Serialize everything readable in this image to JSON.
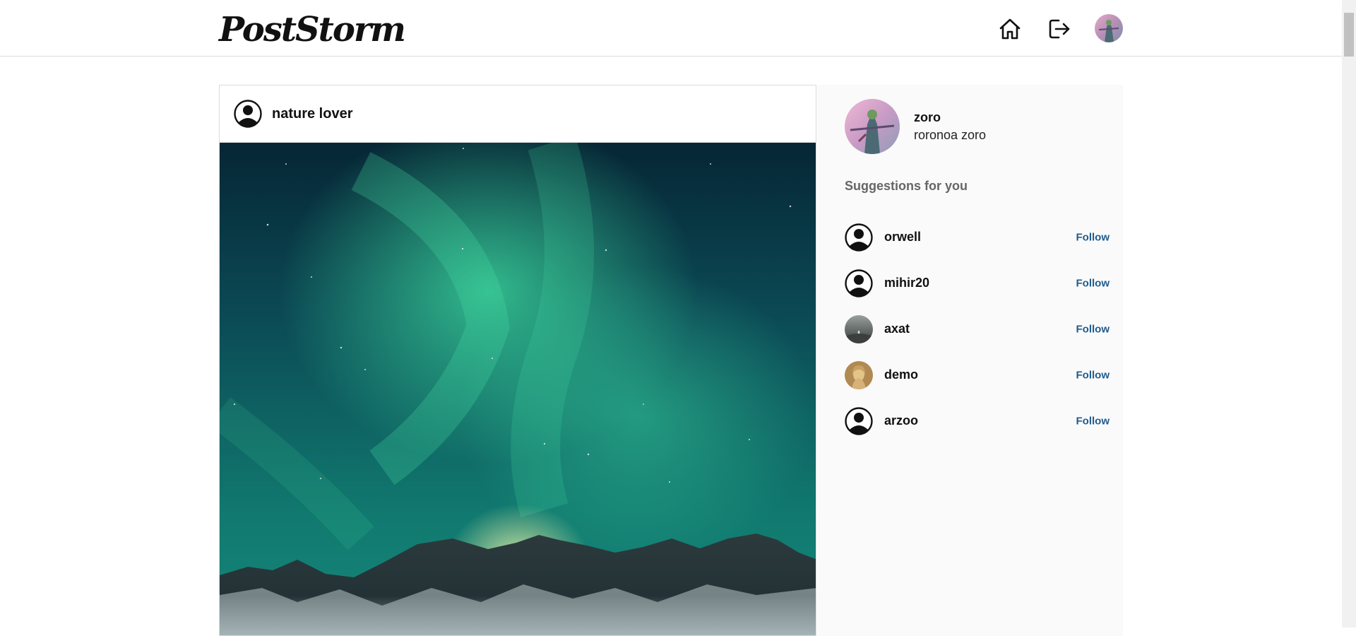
{
  "header": {
    "logo": "PostStorm",
    "home_icon": "home-icon",
    "logout_icon": "logout-icon",
    "avatar_icon": "avatar"
  },
  "post": {
    "username": "nature lover",
    "avatar_icon": "default-user-icon",
    "image_subject": "aurora-over-mountains"
  },
  "sidebar": {
    "me": {
      "username": "zoro",
      "full_name": "roronoa zoro"
    },
    "suggestions_title": "Suggestions for you",
    "suggestions": [
      {
        "username": "orwell",
        "avatar": "default-user-icon",
        "action": "Follow"
      },
      {
        "username": "mihir20",
        "avatar": "default-user-icon",
        "action": "Follow"
      },
      {
        "username": "axat",
        "avatar": "photo",
        "action": "Follow"
      },
      {
        "username": "demo",
        "avatar": "photo",
        "action": "Follow"
      },
      {
        "username": "arzoo",
        "avatar": "default-user-icon",
        "action": "Follow"
      }
    ]
  },
  "colors": {
    "follow_link": "#1f5b8f",
    "sidebar_bg": "#fafafa",
    "border": "#dbdbdb"
  }
}
